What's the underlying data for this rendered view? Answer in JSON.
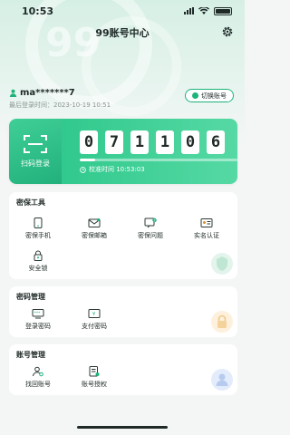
{
  "status_bar": {
    "time": "10:53"
  },
  "header": {
    "title": "99账号中心",
    "deco_text": "99"
  },
  "account": {
    "username": "ma*******7",
    "last_login": "最后登录时间：2023-10-19 10:51",
    "switch_label": "切换账号"
  },
  "token": {
    "scan_label": "扫码登录",
    "digits": [
      "0",
      "7",
      "1",
      "1",
      "0",
      "6"
    ],
    "progress_fraction": 0.1,
    "calibration": "校准时间  10:53:03"
  },
  "sections": {
    "security_tools": {
      "title": "密保工具",
      "items": [
        {
          "label": "密保手机",
          "icon": "phone-icon"
        },
        {
          "label": "密保邮箱",
          "icon": "mail-icon"
        },
        {
          "label": "密保问题",
          "icon": "question-icon"
        },
        {
          "label": "实名认证",
          "icon": "id-card-icon"
        },
        {
          "label": "安全锁",
          "icon": "lock-icon"
        }
      ]
    },
    "password": {
      "title": "密码管理",
      "items": [
        {
          "label": "登录密码",
          "icon": "login-password-icon"
        },
        {
          "label": "支付密码",
          "icon": "pay-password-icon"
        }
      ]
    },
    "account_mgmt": {
      "title": "账号管理",
      "items": [
        {
          "label": "找回账号",
          "icon": "find-account-icon"
        },
        {
          "label": "账号授权",
          "icon": "authorize-icon"
        }
      ]
    }
  },
  "colors": {
    "accent": "#1db37a",
    "card_gradient_start": "#31c98d",
    "card_gradient_end": "#56d9a4"
  }
}
